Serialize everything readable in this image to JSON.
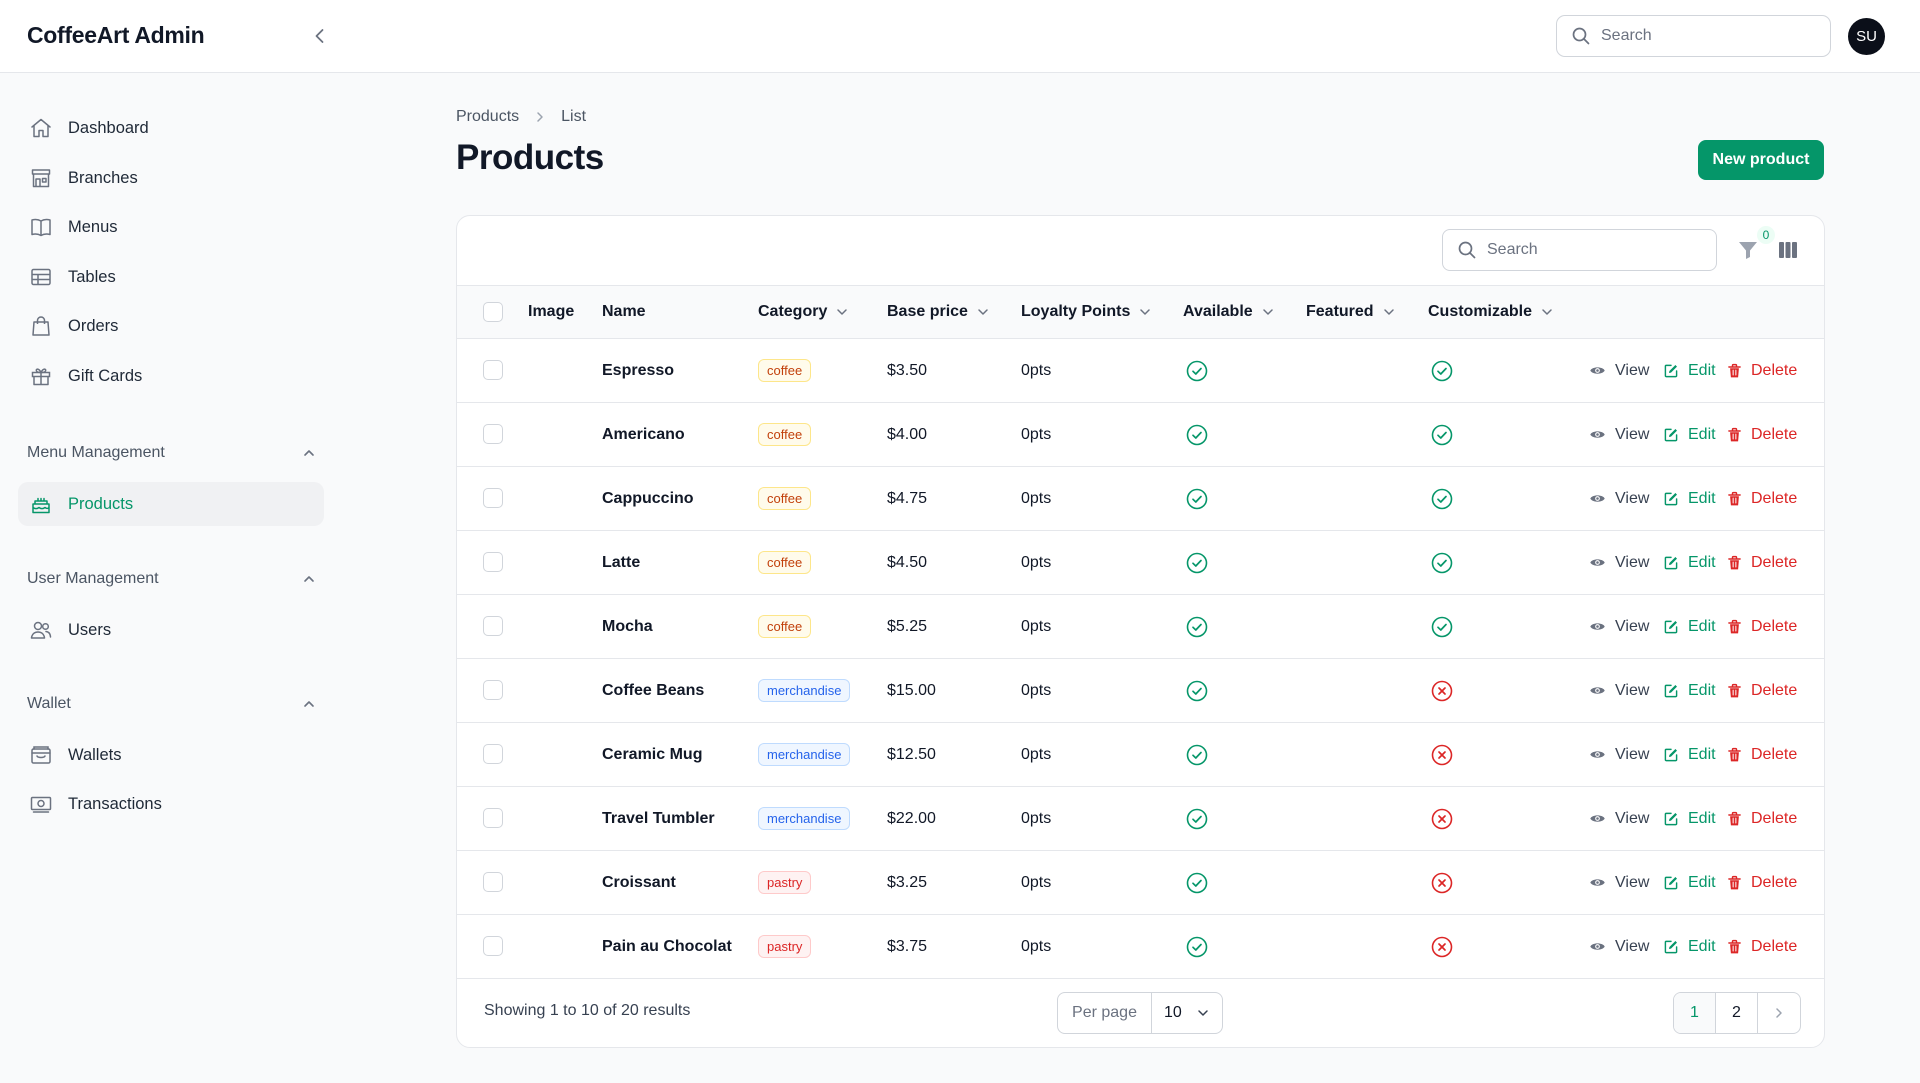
{
  "app": {
    "brand": "CoffeeArt Admin",
    "avatar_initials": "SU"
  },
  "top_search": {
    "placeholder": "Search"
  },
  "sidebar": {
    "items": [
      {
        "label": "Dashboard",
        "icon": "home-icon"
      },
      {
        "label": "Branches",
        "icon": "store-icon"
      },
      {
        "label": "Menus",
        "icon": "book-open-icon"
      },
      {
        "label": "Tables",
        "icon": "table-icon"
      },
      {
        "label": "Orders",
        "icon": "shopping-bag-icon"
      },
      {
        "label": "Gift Cards",
        "icon": "gift-icon"
      }
    ],
    "groups": [
      {
        "label": "Menu Management",
        "items": [
          {
            "label": "Products",
            "icon": "cake-icon",
            "active": true
          }
        ]
      },
      {
        "label": "User Management",
        "items": [
          {
            "label": "Users",
            "icon": "users-icon"
          }
        ]
      },
      {
        "label": "Wallet",
        "items": [
          {
            "label": "Wallets",
            "icon": "wallet-icon"
          },
          {
            "label": "Transactions",
            "icon": "banknotes-icon"
          }
        ]
      }
    ]
  },
  "breadcrumb": {
    "parent": "Products",
    "current": "List"
  },
  "page": {
    "title": "Products",
    "new_button": "New product"
  },
  "table": {
    "search_placeholder": "Search",
    "filter_count": "0",
    "columns": {
      "image": "Image",
      "name": "Name",
      "category": "Category",
      "base_price": "Base price",
      "loyalty_points": "Loyalty Points",
      "available": "Available",
      "featured": "Featured",
      "customizable": "Customizable"
    },
    "actions": {
      "view": "View",
      "edit": "Edit",
      "delete": "Delete"
    },
    "rows": [
      {
        "name": "Espresso",
        "category": "coffee",
        "price": "$3.50",
        "points": "0pts",
        "available": true,
        "customizable": true
      },
      {
        "name": "Americano",
        "category": "coffee",
        "price": "$4.00",
        "points": "0pts",
        "available": true,
        "customizable": true
      },
      {
        "name": "Cappuccino",
        "category": "coffee",
        "price": "$4.75",
        "points": "0pts",
        "available": true,
        "customizable": true
      },
      {
        "name": "Latte",
        "category": "coffee",
        "price": "$4.50",
        "points": "0pts",
        "available": true,
        "customizable": true
      },
      {
        "name": "Mocha",
        "category": "coffee",
        "price": "$5.25",
        "points": "0pts",
        "available": true,
        "customizable": true
      },
      {
        "name": "Coffee Beans",
        "category": "merchandise",
        "price": "$15.00",
        "points": "0pts",
        "available": true,
        "customizable": false
      },
      {
        "name": "Ceramic Mug",
        "category": "merchandise",
        "price": "$12.50",
        "points": "0pts",
        "available": true,
        "customizable": false
      },
      {
        "name": "Travel Tumbler",
        "category": "merchandise",
        "price": "$22.00",
        "points": "0pts",
        "available": true,
        "customizable": false
      },
      {
        "name": "Croissant",
        "category": "pastry",
        "price": "$3.25",
        "points": "0pts",
        "available": true,
        "customizable": false
      },
      {
        "name": "Pain au Chocolat",
        "category": "pastry",
        "price": "$3.75",
        "points": "0pts",
        "available": true,
        "customizable": false
      }
    ],
    "footer": {
      "summary": "Showing 1 to 10 of 20 results",
      "per_page_label": "Per page",
      "per_page_value": "10",
      "pages": [
        "1",
        "2"
      ],
      "current_page": "1"
    }
  },
  "colors": {
    "accent": "#059669",
    "danger": "#dc2626",
    "info": "#2563eb",
    "warning": "#c2410c"
  }
}
